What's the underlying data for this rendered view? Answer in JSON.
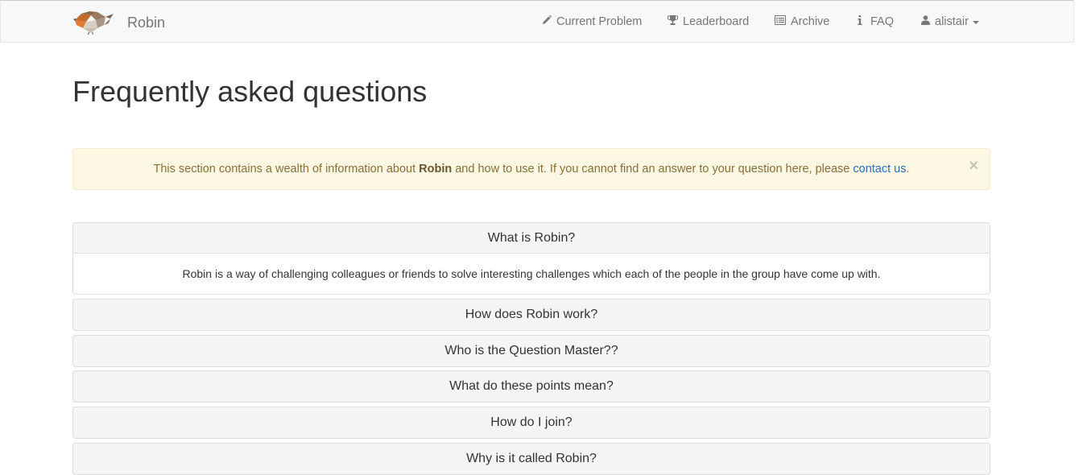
{
  "navbar": {
    "brand_name": "Robin",
    "items": [
      {
        "label": "Current Problem",
        "icon": "pencil-icon"
      },
      {
        "label": "Leaderboard",
        "icon": "trophy-icon"
      },
      {
        "label": "Archive",
        "icon": "list-alt-icon"
      },
      {
        "label": "FAQ",
        "icon": "info-icon"
      },
      {
        "label": "alistair",
        "icon": "user-icon"
      }
    ]
  },
  "page": {
    "title": "Frequently asked questions"
  },
  "alert": {
    "text_before": "This section contains a wealth of information about ",
    "bold": "Robin",
    "text_middle": " and how to use it. If you cannot find an answer to your question here, please ",
    "link": "contact us",
    "text_after": ".",
    "close": "×"
  },
  "faq": [
    {
      "question": "What is Robin?",
      "answer": "Robin is a way of challenging colleagues or friends to solve interesting challenges which each of the people in the group have come up with."
    },
    {
      "question": "How does Robin work?"
    },
    {
      "question": "Who is the Question Master??"
    },
    {
      "question": "What do these points mean?"
    },
    {
      "question": "How do I join?"
    },
    {
      "question": "Why is it called Robin?"
    }
  ],
  "colors": {
    "alert_bg": "#fcf8e3",
    "alert_text": "#8a6d3b",
    "link": "#2a6eb3",
    "navbar_bg": "#f8f8f8"
  }
}
